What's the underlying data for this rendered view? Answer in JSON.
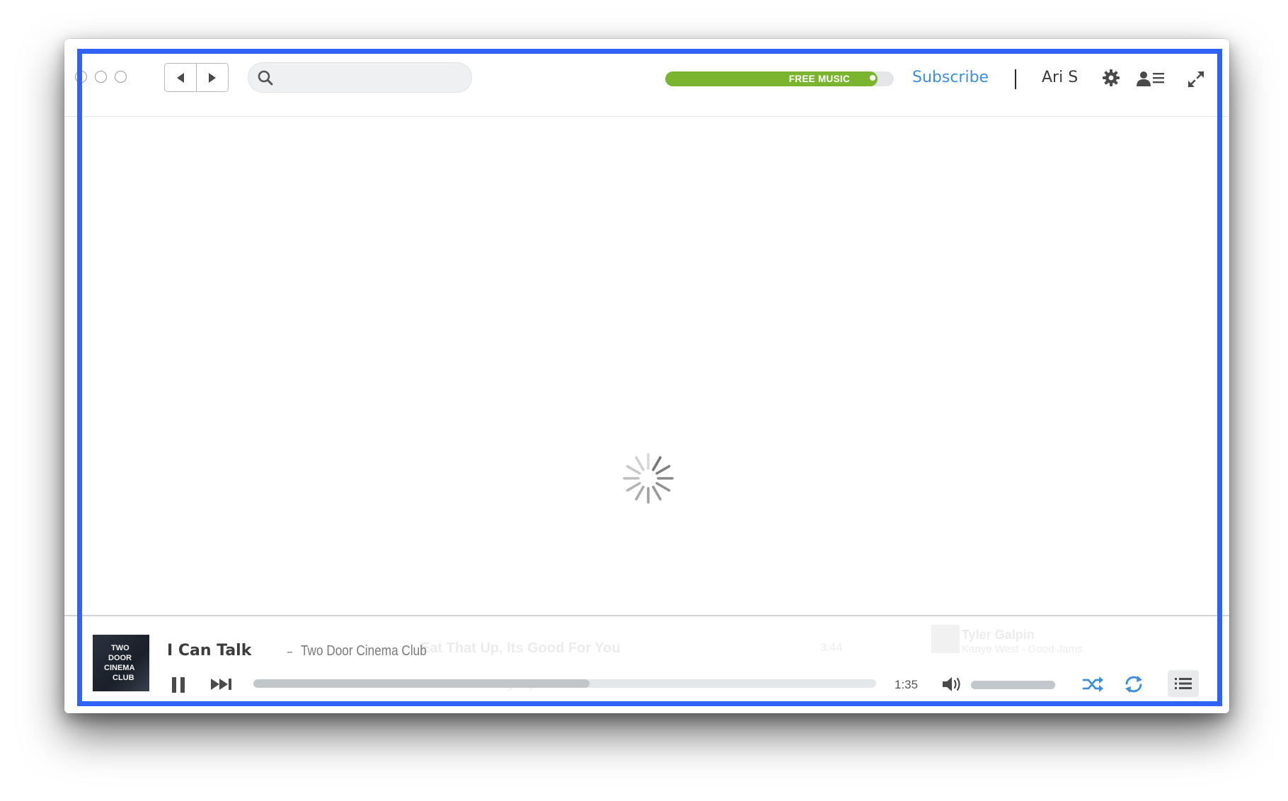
{
  "topbar": {
    "search_placeholder": "",
    "free_music_label": "FREE MUSIC",
    "free_music_progress": 0.93,
    "subscribe_label": "Subscribe",
    "username": "Ari S"
  },
  "content": {
    "state": "loading"
  },
  "player": {
    "track_title": "I Can Talk",
    "separator": "–",
    "artist": "Two Door Cinema Club",
    "album_art_text": [
      "TWO",
      "DOOR",
      "CINEMA",
      "CLUB"
    ],
    "elapsed": "1:35",
    "progress_fraction": 0.54,
    "volume_fraction": 1.0,
    "background_rows": [
      {
        "title": "Eat That Up, Its Good For You",
        "duration": "3:44"
      },
      {
        "title": "You're Not Fooling Anyone"
      }
    ],
    "background_card": {
      "name": "Tyler Galpin",
      "subtitle": "Kanye West - Good Jams"
    }
  },
  "colors": {
    "accent_blue": "#3e8fd8",
    "free_music_green": "#7bb52f",
    "selection_frame": "#2f62f5"
  },
  "icons": {
    "back": "chevron-left-icon",
    "forward": "chevron-right-icon",
    "search": "search-icon",
    "settings": "gear-icon",
    "profile": "profile-list-icon",
    "fullscreen": "expand-icon",
    "pause": "pause-icon",
    "next": "skip-next-icon",
    "volume": "volume-icon",
    "shuffle": "shuffle-icon",
    "repeat": "repeat-icon",
    "queue": "queue-list-icon",
    "loading": "spinner-icon"
  }
}
